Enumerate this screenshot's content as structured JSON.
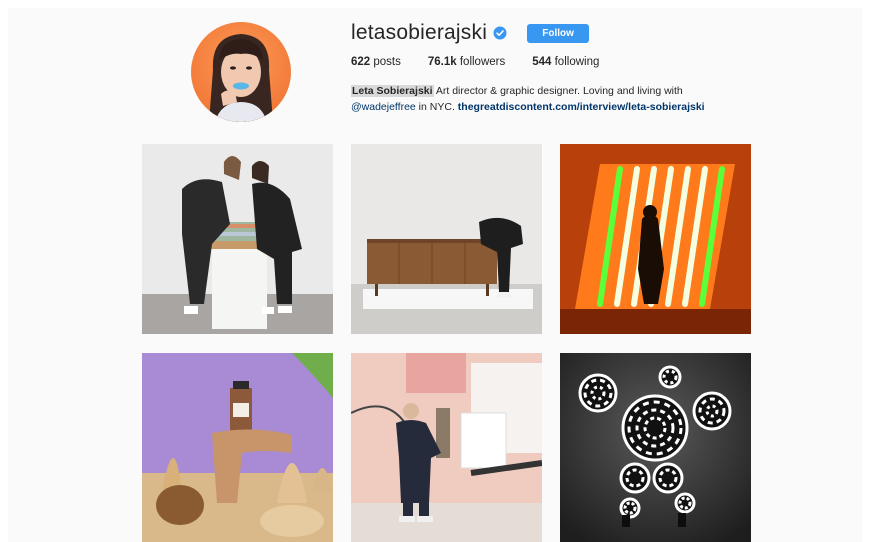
{
  "profile": {
    "username": "letasobierajski",
    "verified_icon": "verified-badge-icon",
    "follow_label": "Follow",
    "stats": {
      "posts_count": "622",
      "posts_label": " posts",
      "followers_count": "76.1k",
      "followers_label": " followers",
      "following_count": "544",
      "following_label": " following"
    },
    "bio": {
      "full_name": "Leta Sobierajski",
      "line1_rest": " Art director & graphic designer. Loving and living with",
      "mention": "@wadejeffree",
      "line2_mid": " in NYC. ",
      "link": "thegreatdiscontent.com/interview/leta-sobierajski"
    }
  },
  "posts": [
    {
      "subject": "two-people-on-striped-bench"
    },
    {
      "subject": "wooden-sideboard-with-person"
    },
    {
      "subject": "neon-green-light-installation"
    },
    {
      "subject": "perfume-bottle-sand-sculpture"
    },
    {
      "subject": "person-in-pastel-installation"
    },
    {
      "subject": "spiral-pattern-sculpture"
    }
  ],
  "colors": {
    "follow_button": "#3897f0",
    "link": "#003569",
    "background": "#fafafa",
    "avatar_bg": "#f27b3a"
  }
}
